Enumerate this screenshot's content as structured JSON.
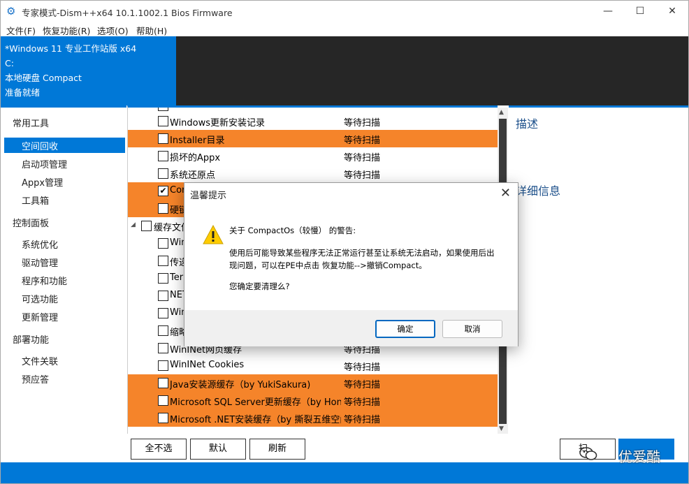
{
  "window": {
    "title": "专家模式-Dism++x64 10.1.1002.1 Bios Firmware",
    "minimize_icon": "—",
    "maximize_icon": "☐",
    "close_icon": "✕"
  },
  "menu": {
    "items": [
      "文件(F)",
      "恢复功能(R)",
      "选项(O)",
      "帮助(H)"
    ]
  },
  "system_info": {
    "os": "*Windows 11 专业工作站版 x64",
    "drive": "C:",
    "disk": "本地硬盘 Compact",
    "status": "准备就绪"
  },
  "sidebar": {
    "sections": [
      {
        "title": "常用工具",
        "items": [
          "空间回收",
          "启动项管理",
          "Appx管理",
          "工具箱"
        ]
      },
      {
        "title": "控制面板",
        "items": [
          "系统优化",
          "驱动管理",
          "程序和功能",
          "可选功能",
          "更新管理"
        ]
      },
      {
        "title": "部署功能",
        "items": [
          "文件关联",
          "预应答"
        ]
      }
    ],
    "selected": "空间回收"
  },
  "list": {
    "rows": [
      {
        "name": "Windows更新安装记录",
        "status": "等待扫描",
        "checked": false,
        "highlight": false
      },
      {
        "name": "Installer目录",
        "status": "等待扫描",
        "checked": false,
        "highlight": true
      },
      {
        "name": "损坏的Appx",
        "status": "等待扫描",
        "checked": false,
        "highlight": false
      },
      {
        "name": "系统还原点",
        "status": "等待扫描",
        "checked": false,
        "highlight": false
      },
      {
        "name": "Cor",
        "status": "",
        "checked": true,
        "highlight": true
      },
      {
        "name": "硬链",
        "status": "",
        "checked": false,
        "highlight": true
      },
      {
        "name": "缓存文件",
        "status": "",
        "checked": false,
        "highlight": false,
        "group": true
      },
      {
        "name": "Win",
        "status": "",
        "checked": false,
        "highlight": false
      },
      {
        "name": "传递",
        "status": "",
        "checked": false,
        "highlight": false
      },
      {
        "name": "Terr",
        "status": "",
        "checked": false,
        "highlight": false
      },
      {
        "name": "NET",
        "status": "",
        "checked": false,
        "highlight": false
      },
      {
        "name": "Win",
        "status": "",
        "checked": false,
        "highlight": false
      },
      {
        "name": "缩略",
        "status": "",
        "checked": false,
        "highlight": false
      },
      {
        "name": "WinINet网页缓存",
        "status": "等待扫描",
        "checked": false,
        "highlight": false
      },
      {
        "name": "WinINet Cookies",
        "status": "等待扫描",
        "checked": false,
        "highlight": false
      },
      {
        "name": "Java安装源缓存（by YukiSakura)",
        "status": "等待扫描",
        "checked": false,
        "highlight": true
      },
      {
        "name": "Microsoft SQL Server更新缓存（by Honry、",
        "status": "等待扫描",
        "checked": false,
        "highlight": true
      },
      {
        "name": "Microsoft .NET安装缓存（by 撕裂五维空间)",
        "status": "等待扫描",
        "checked": false,
        "highlight": true
      }
    ]
  },
  "right_pane": {
    "description_title": "描述",
    "details_title": "详细信息"
  },
  "buttons": {
    "deselect_all": "全不选",
    "default": "默认",
    "refresh": "刷新",
    "scan_partial": "扫"
  },
  "watermark": {
    "text": "优爱酷"
  },
  "dialog": {
    "title": "温馨提示",
    "heading": "关于 CompactOs（较慢） 的警告:",
    "body": "使用后可能导致某些程序无法正常运行甚至让系统无法启动，如果使用后出现问题，可以在PE中点击 恢复功能-->撤销Compact。",
    "question": "您确定要清理么?",
    "ok": "确定",
    "cancel": "取消",
    "close_icon": "✕"
  },
  "colors": {
    "accent_blue": "#0078d7",
    "highlight_orange": "#f5842a",
    "dark_panel": "#262626"
  }
}
